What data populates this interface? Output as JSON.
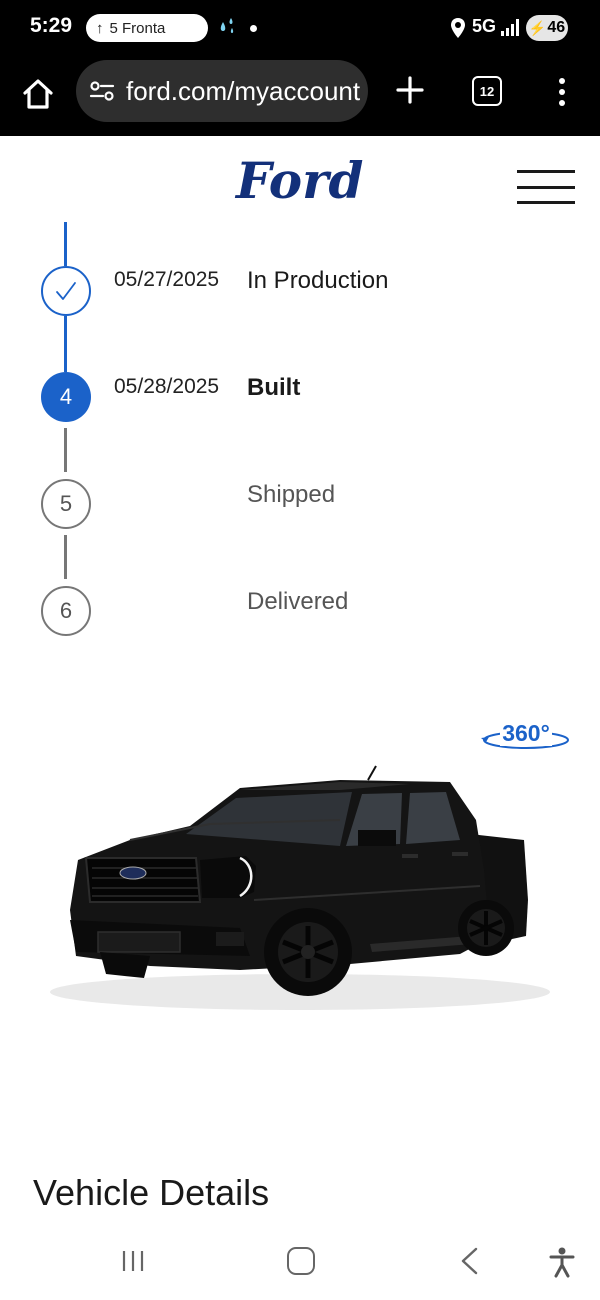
{
  "status_bar": {
    "time": "5:29",
    "nav_pill_text": "5 Fronta",
    "network": "5G",
    "battery": "46"
  },
  "browser": {
    "url": "ford.com/myaccount",
    "tab_count": "12"
  },
  "header": {
    "logo_text": "Ford"
  },
  "timeline": {
    "steps": [
      {
        "marker": "check",
        "date": "05/27/2025",
        "label": "In Production",
        "status": "done"
      },
      {
        "marker": "4",
        "date": "05/28/2025",
        "label": "Built",
        "status": "active"
      },
      {
        "marker": "5",
        "date": "",
        "label": "Shipped",
        "status": "pending"
      },
      {
        "marker": "6",
        "date": "",
        "label": "Delivered",
        "status": "pending"
      }
    ]
  },
  "vehicle": {
    "view_360_label": "360°",
    "image_icon": "pickup-truck-image"
  },
  "sections": {
    "vehicle_details_title": "Vehicle Details"
  },
  "colors": {
    "accent": "#1b62c9",
    "ford_blue": "#13307a",
    "pending": "#777777"
  }
}
